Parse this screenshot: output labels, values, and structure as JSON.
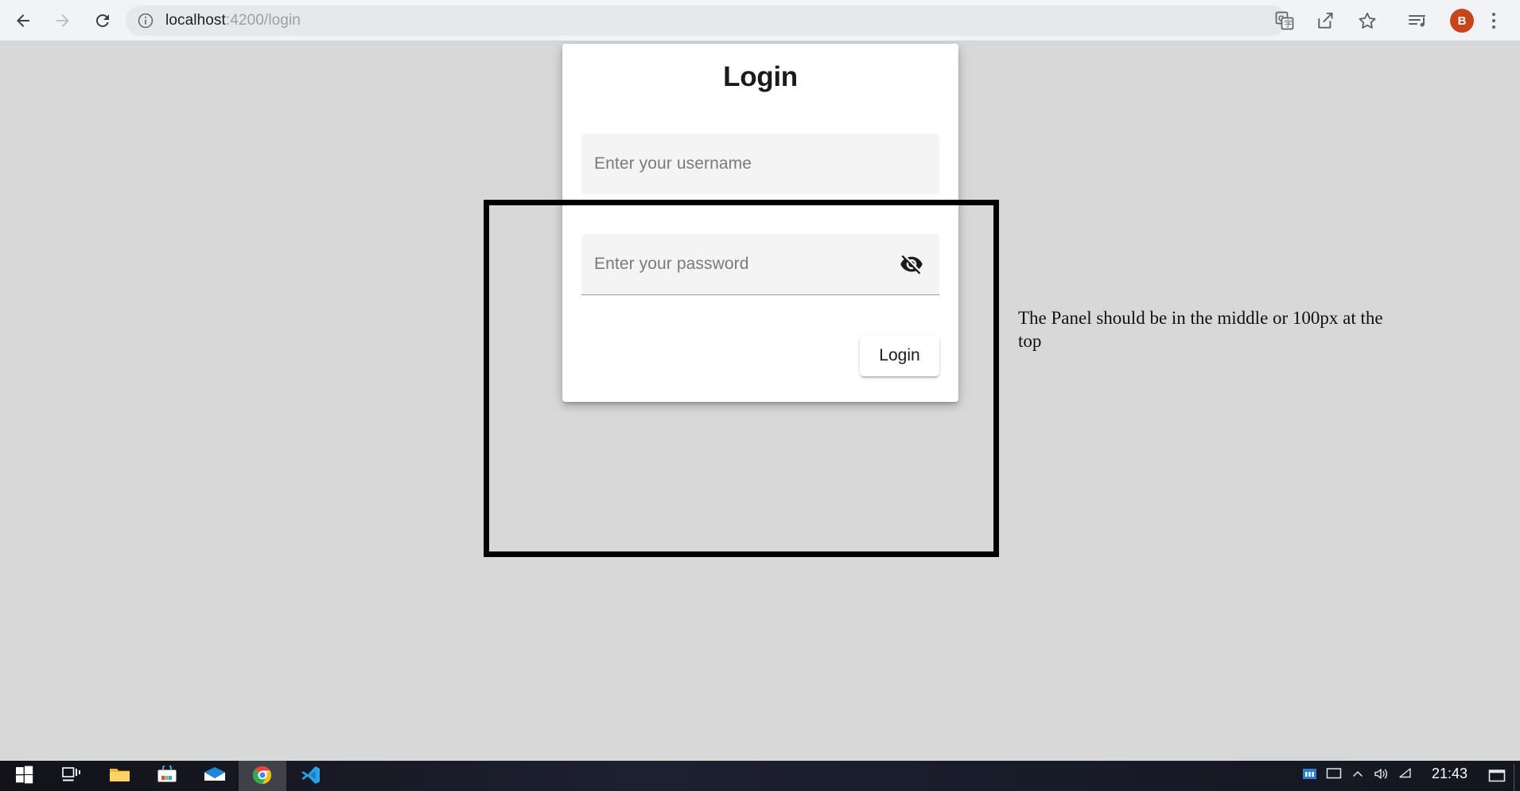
{
  "browser": {
    "back_label": "Back",
    "forward_label": "Forward",
    "reload_label": "Reload",
    "url_host": "localhost",
    "url_path": ":4200/login",
    "url_full": "localhost:4200/login",
    "site_info_label": "View site information",
    "actions": {
      "translate_label": "Translate this page",
      "share_label": "Share this page",
      "bookmark_label": "Bookmark this tab",
      "media_label": "Media controls",
      "profile_initial": "B",
      "menu_label": "Customize and control Google Chrome"
    }
  },
  "login": {
    "title": "Login",
    "username_placeholder": "Enter your username",
    "username_value": "",
    "password_placeholder": "Enter your password",
    "password_value": "",
    "toggle_visibility_label": "Hide password",
    "submit_label": "Login"
  },
  "annotation": {
    "note": "The Panel should be in the middle or 100px  at the top",
    "border_color": "#000000"
  },
  "taskbar": {
    "start_label": "Start",
    "task_view_label": "Task View",
    "file_explorer_label": "File Explorer",
    "store_label": "Microsoft Store",
    "mail_label": "Mail",
    "chrome_label": "Google Chrome",
    "vscode_label": "Visual Studio Code",
    "clock": "21:43",
    "tray_chevron_label": "Show hidden icons",
    "network_label": "Network",
    "volume_label": "Volume",
    "action_center_label": "Notifications"
  },
  "colors": {
    "page_background": "#d8d8d8",
    "card_background": "#ffffff",
    "field_background": "#f4f4f4",
    "toolbar_background": "#f1f3f4",
    "avatar_background": "#c8441c",
    "annotation_border": "#000000",
    "taskbar_background": "#1b1b22"
  }
}
